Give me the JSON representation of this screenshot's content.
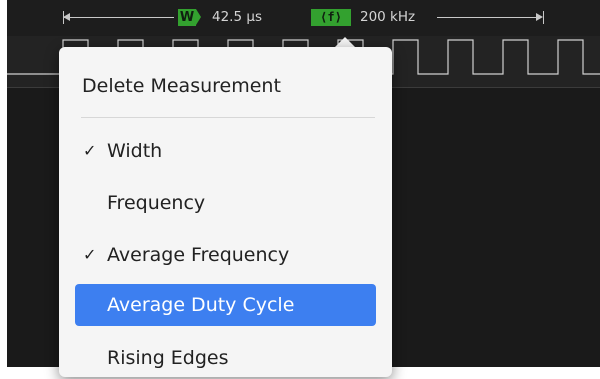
{
  "measurement": {
    "width_badge": "W",
    "width_value": "42.5 µs",
    "freq_badge": "⟨f⟩",
    "freq_value": "200 kHz"
  },
  "menu": {
    "header": "Delete Measurement",
    "items": [
      {
        "label": "Width",
        "check": "✓"
      },
      {
        "label": "Frequency",
        "check": ""
      },
      {
        "label": "Average Frequency",
        "check": "✓"
      },
      {
        "label": "Average Duty Cycle",
        "check": ""
      },
      {
        "label": "Rising Edges",
        "check": ""
      }
    ],
    "selected_index": 3
  },
  "colors": {
    "badge": "#33a12f",
    "selection": "#3d7ff0",
    "background": "#1a1a1a",
    "signal": "#d0d0d0"
  }
}
